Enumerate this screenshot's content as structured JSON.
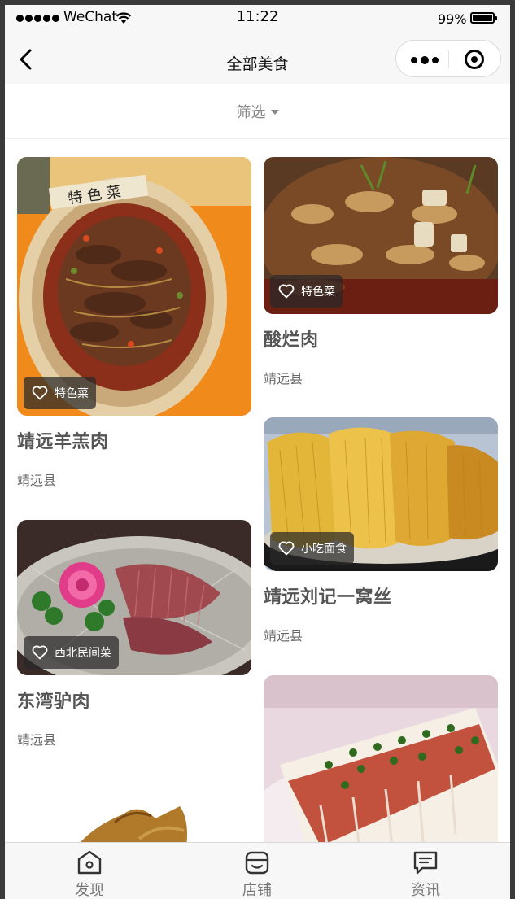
{
  "status_bar": {
    "carrier": "WeChat",
    "time": "11:22",
    "battery": "99%",
    "battery_level": 0.99
  },
  "nav": {
    "title": "全部美食",
    "back_icon": "chevron-left-icon",
    "menu_icon": "more-dots-icon",
    "close_icon": "target-circle-icon"
  },
  "filter": {
    "label": "筛选",
    "icon": "caret-down-icon"
  },
  "items": [
    {
      "title": "靖远羊羔肉",
      "location": "靖远县",
      "tag": "特色菜",
      "tag_icon": "heart-outline-icon"
    },
    {
      "title": "酸烂肉",
      "location": "靖远县",
      "tag": "特色菜",
      "tag_icon": "heart-outline-icon"
    },
    {
      "title": "靖远刘记一窝丝",
      "location": "靖远县",
      "tag": "小吃面食",
      "tag_icon": "heart-outline-icon"
    },
    {
      "title": "东湾驴肉",
      "location": "靖远县",
      "tag": "西北民间菜",
      "tag_icon": "heart-outline-icon"
    }
  ],
  "tabbar": {
    "tabs": [
      {
        "label": "发现",
        "icon": "home-outline-icon"
      },
      {
        "label": "店铺",
        "icon": "store-outline-icon"
      },
      {
        "label": "资讯",
        "icon": "message-outline-icon"
      }
    ]
  },
  "colors": {
    "background": "#ffffff",
    "bar": "#f7f7f7",
    "title_text": "#555555",
    "secondary_text": "#666666",
    "tag_background": "#282828"
  }
}
